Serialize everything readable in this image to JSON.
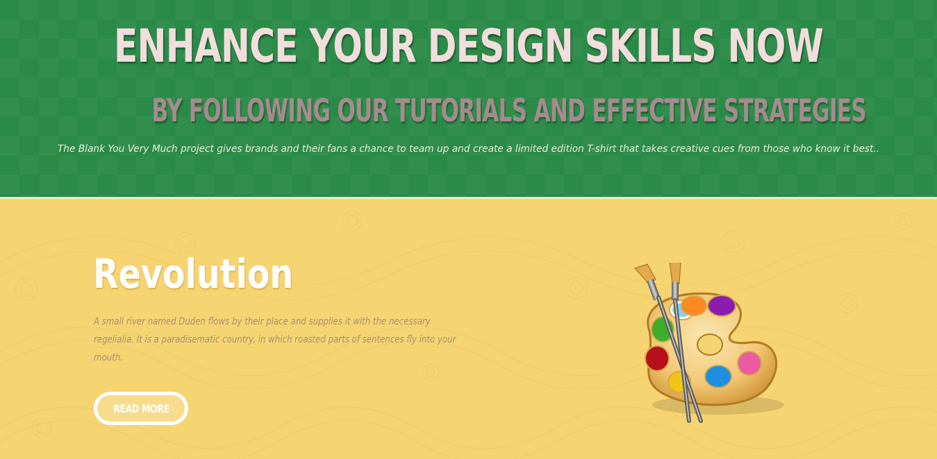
{
  "hero": {
    "title": "ENHANCE YOUR DESIGN SKILLS NOW",
    "subtitle": "BY FOLLOWING OUR TUTORIALS AND EFFECTIVE STRATEGIES",
    "text": "The Blank You Very Much project gives brands and their fans a chance to team up and create a limited edition T-shirt that takes creative cues from those who know it best.."
  },
  "feature": {
    "title": "Revolution",
    "text": "A small river named Duden flows by their place and supplies it with the necessary regelialia. It is a paradisematic country, in which roasted parts of sentences fly into your mouth.",
    "button_label": "READ MORE",
    "image_icon": "paint-palette-icon"
  },
  "colors": {
    "hero_background": "#2a8a47",
    "hero_title": "#f2dddd",
    "hero_subtitle": "#a58b8f",
    "feature_background": "#f6d472",
    "feature_title": "#ffffff",
    "feature_text": "#a6916f"
  }
}
